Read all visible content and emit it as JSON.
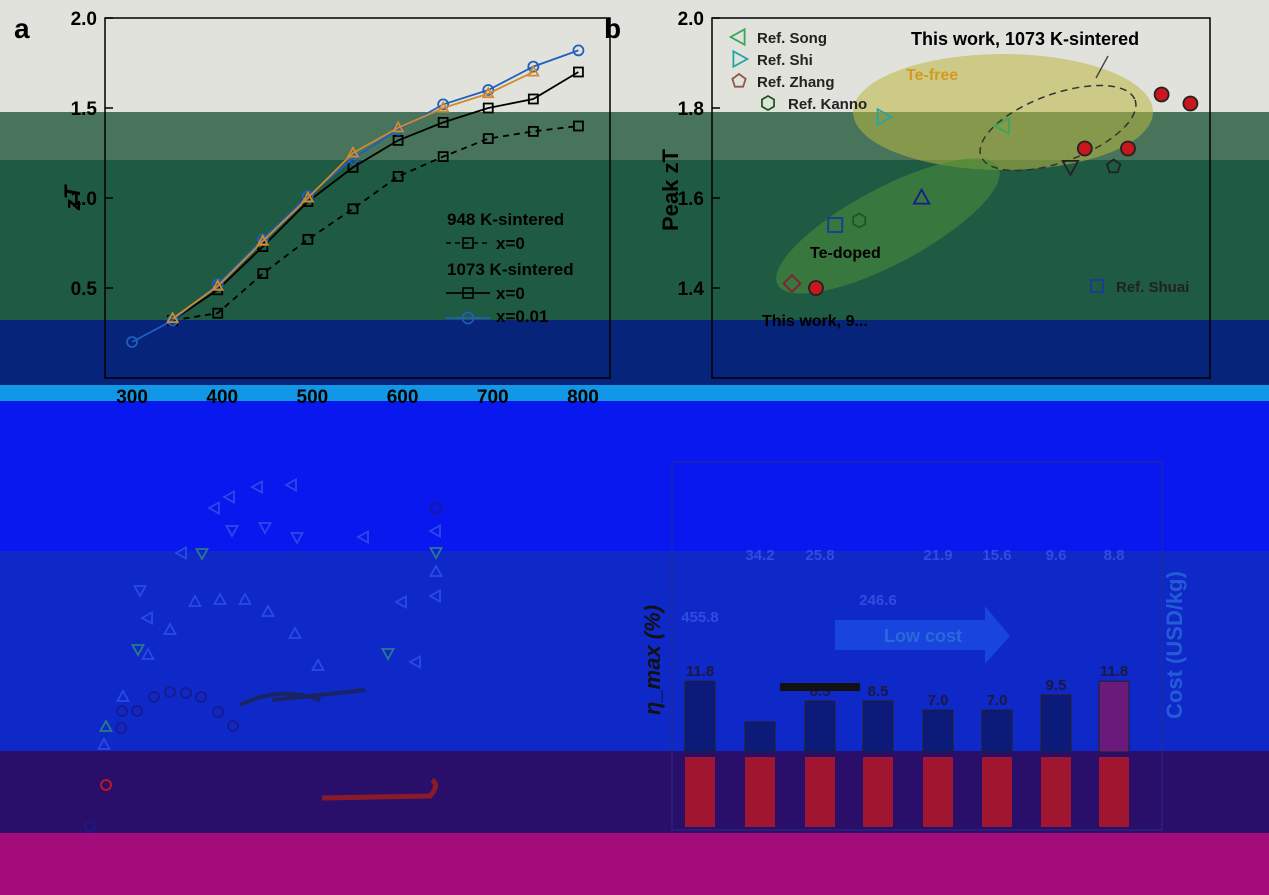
{
  "panel_letters": [
    "a",
    "b"
  ],
  "chart_data": [
    {
      "type": "line",
      "panel": "a",
      "xlabel": "",
      "ylabel": "zT",
      "xlim": [
        270,
        830
      ],
      "ylim": [
        0,
        2.0
      ],
      "x_ticks": [
        300,
        400,
        500,
        600,
        700,
        800
      ],
      "y_ticks": [
        0.5,
        1.0,
        1.5,
        2.0
      ],
      "y_tick_labels": [
        "0.5",
        "1.0",
        "1.5",
        "2.0"
      ],
      "legend_position": "bottom-right",
      "legend_groups": [
        {
          "header": "948 K-sintered",
          "entries": [
            "x=0"
          ]
        },
        {
          "header": "1073 K-sintered",
          "entries": [
            "x=0",
            "x=0.01"
          ]
        }
      ],
      "series": [
        {
          "name": "948 K-sintered x=0",
          "color": "#000000",
          "dash": "dashed",
          "marker": "square",
          "x": [
            345,
            395,
            445,
            495,
            545,
            595,
            645,
            695,
            745,
            795
          ],
          "y": [
            0.32,
            0.36,
            0.58,
            0.77,
            0.94,
            1.12,
            1.23,
            1.33,
            1.37,
            1.4
          ]
        },
        {
          "name": "1073 K-sintered x=0",
          "color": "#000000",
          "dash": "solid",
          "marker": "square",
          "x": [
            345,
            395,
            445,
            495,
            545,
            595,
            645,
            695,
            745,
            795
          ],
          "y": [
            0.32,
            0.49,
            0.73,
            0.98,
            1.17,
            1.32,
            1.42,
            1.5,
            1.55,
            1.7
          ]
        },
        {
          "name": "x=0.01",
          "color": "#1f5fbf",
          "dash": "solid",
          "marker": "circle",
          "x": [
            300,
            345,
            395,
            445,
            495,
            545,
            595,
            645,
            695,
            745,
            795
          ],
          "y": [
            0.2,
            0.32,
            0.52,
            0.77,
            1.01,
            1.22,
            1.38,
            1.52,
            1.6,
            1.73,
            1.82
          ]
        },
        {
          "name": "",
          "color": "#d08a2e",
          "dash": "solid",
          "marker": "triangle",
          "x": [
            345,
            395,
            445,
            495,
            545,
            595,
            645,
            695,
            745
          ],
          "y": [
            0.33,
            0.51,
            0.76,
            1.0,
            1.25,
            1.39,
            1.5,
            1.58,
            1.7
          ]
        }
      ]
    },
    {
      "type": "scatter",
      "panel": "b",
      "xlabel": "",
      "ylabel": "Peak zT",
      "ylim": [
        1.2,
        2.0
      ],
      "y_ticks": [
        1.4,
        1.6,
        1.8,
        2.0
      ],
      "y_tick_labels": [
        "1.4",
        "1.6",
        "1.8",
        "2.0"
      ],
      "annotations": [
        "This work, 1073 K-sintered",
        "Te-free",
        "Te-doped",
        "This work, 9..."
      ],
      "legend_top": [
        {
          "label": "Ref. Song",
          "marker": "triangle-left",
          "color": "#3aa65a"
        },
        {
          "label": "Ref. Shi",
          "marker": "triangle-right",
          "color": "#20a7a7"
        },
        {
          "label": "Ref. Zhang",
          "marker": "pentagon",
          "color": "#8a5a4a"
        },
        {
          "label": "Ref. Kanno",
          "marker": "hexagon",
          "color": "#1a5a1a"
        }
      ],
      "legend_bottom": [
        {
          "label": "Ref. Shuai",
          "marker": "square",
          "color": "#1a3a9a"
        }
      ],
      "points": [
        {
          "label": "Ref. Song",
          "x": 4.4,
          "y": 1.76
        },
        {
          "label": "Ref. Shi",
          "x": 1.9,
          "y": 1.78
        },
        {
          "label": "Ref. Zhang",
          "x": 6.7,
          "y": 1.67
        },
        {
          "label": "Ref. Kanno",
          "x": 1.4,
          "y": 1.55
        },
        {
          "label": "Ref. Shuai",
          "x": 0.9,
          "y": 1.54
        },
        {
          "label": "",
          "x": 2.7,
          "y": 1.6
        },
        {
          "label": "",
          "x": 5.8,
          "y": 1.67
        },
        {
          "label": "",
          "x": 0.0,
          "y": 1.41
        },
        {
          "label": "This work, 1073 K-sintered",
          "x": 6.1,
          "y": 1.71
        },
        {
          "label": "This work, 1073 K-sintered",
          "x": 7.0,
          "y": 1.71
        },
        {
          "label": "This work, 1073 K-sintered",
          "x": 7.7,
          "y": 1.83
        },
        {
          "label": "This work, 1073 K-sintered",
          "x": 8.3,
          "y": 1.81
        },
        {
          "label": "This work, 9...",
          "x": 0.5,
          "y": 1.4
        }
      ]
    },
    {
      "type": "bar",
      "panel": "d",
      "ylabel": "η_max (%)",
      "y2label": "Cost (USD/kg)",
      "annotations": [
        "Low cost"
      ],
      "cost_values": [
        455.8,
        34.2,
        25.8,
        246.6,
        21.9,
        15.6,
        9.6,
        8.8
      ],
      "efficiency_values": [
        11.8,
        5.0,
        8.5,
        8.5,
        7.0,
        7.0,
        9.5,
        11.8
      ],
      "efficiency_labels": [
        "11.8",
        "",
        "8.5",
        "8.5",
        "7.0",
        "7.0",
        "9.5",
        "11.8"
      ]
    }
  ]
}
